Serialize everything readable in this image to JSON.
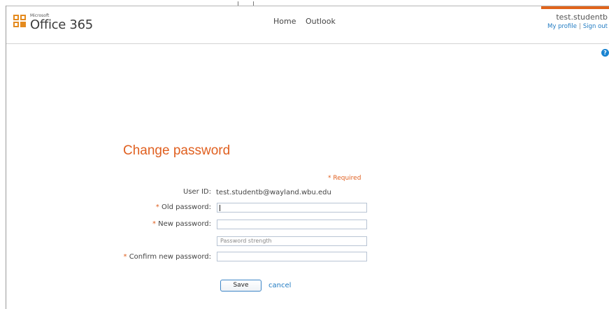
{
  "header": {
    "brand_small": "Microsoft",
    "brand": "Office 365",
    "nav": [
      "Home",
      "Outlook"
    ],
    "user_name": "test.studentb",
    "my_profile": "My profile",
    "separator": "|",
    "sign_out": "Sign out",
    "accent_color": "#e0641c"
  },
  "help": {
    "glyph": "?"
  },
  "form": {
    "title": "Change password",
    "required_note": "* Required",
    "user_id_label": "User ID:",
    "user_id_value": "test.studentb@wayland.wbu.edu",
    "asterisk": "*",
    "old_password_label": "Old password:",
    "old_password_value": "",
    "new_password_label": "New password:",
    "new_password_value": "",
    "strength_text": "Password strength",
    "confirm_label": "Confirm new password:",
    "confirm_value": "",
    "save_label": "Save",
    "cancel_label": "cancel",
    "title_color": "#e06020",
    "link_color": "#1f7ac2"
  }
}
